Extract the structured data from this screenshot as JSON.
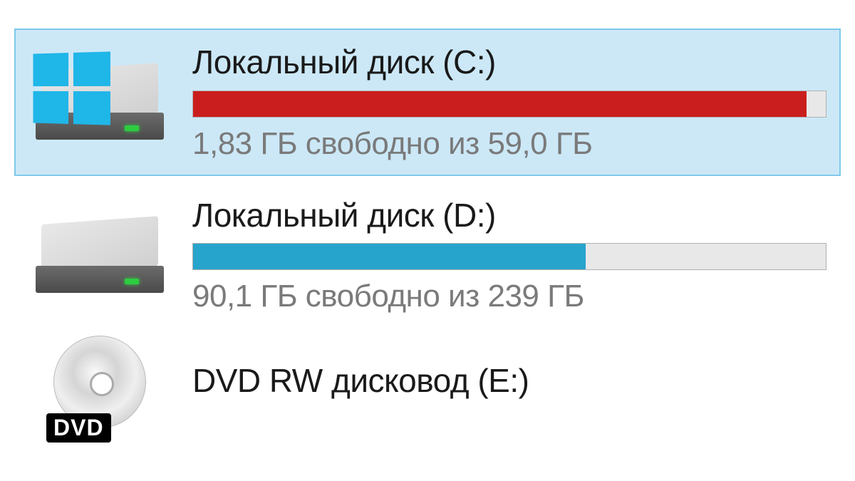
{
  "drives": [
    {
      "label": "Локальный диск (C:)",
      "status": "1,83 ГБ свободно из 59,0 ГБ",
      "fill_percent": 97,
      "fill_color": "#ca1e1e",
      "selected": true,
      "icon": "system-drive"
    },
    {
      "label": "Локальный диск (D:)",
      "status": "90,1 ГБ свободно из 239 ГБ",
      "fill_percent": 62,
      "fill_color": "#27a4cc",
      "selected": false,
      "icon": "hdd"
    },
    {
      "label": "DVD RW дисковод (E:)",
      "status": "",
      "fill_percent": null,
      "fill_color": null,
      "selected": false,
      "icon": "dvd"
    }
  ]
}
